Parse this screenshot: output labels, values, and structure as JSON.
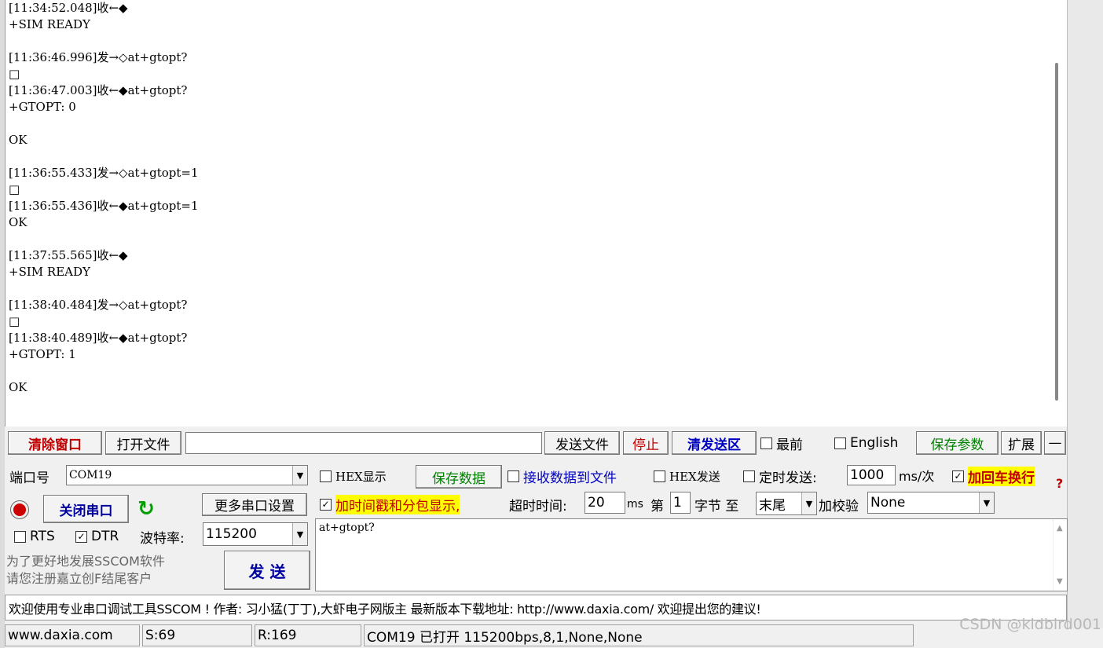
{
  "receive_log": "[11:34:52.048]收←◆\n+SIM READY\n\n[11:36:46.996]发→◇at+gtopt?\n□\n[11:36:47.003]收←◆at+gtopt?\n+GTOPT: 0\n\nOK\n\n[11:36:55.433]发→◇at+gtopt=1\n□\n[11:36:55.436]收←◆at+gtopt=1\nOK\n\n[11:37:55.565]收←◆\n+SIM READY\n\n[11:38:40.484]发→◇at+gtopt?\n□\n[11:38:40.489]收←◆at+gtopt?\n+GTOPT: 1\n\nOK",
  "toolbar": {
    "clear_window": "清除窗口",
    "open_file": "打开文件",
    "file_path": "",
    "send_file": "发送文件",
    "stop": "停止",
    "clear_send": "清发送区",
    "topmost": "最前",
    "english": "English",
    "save_params": "保存参数",
    "expand": "扩展",
    "collapse": "—"
  },
  "port": {
    "port_label": "端口号",
    "port_value": "COM19",
    "close_port": "关闭串口",
    "more_settings": "更多串口设置",
    "rts": "RTS",
    "dtr": "DTR",
    "baud_label": "波特率:",
    "baud_value": "115200"
  },
  "options": {
    "hex_display": "HEX显示",
    "save_data": "保存数据",
    "recv_to_file": "接收数据到文件",
    "hex_send": "HEX发送",
    "timed_send": "定时发送:",
    "interval": "1000",
    "interval_unit": "ms/次",
    "add_crlf": "加回车换行",
    "timestamp": "加时间戳和分包显示,",
    "timeout_label": "超时时间:",
    "timeout_value": "20",
    "timeout_unit": "ms",
    "nth_label": "第",
    "nth_value": "1",
    "byte_to": "字节 至",
    "end_value": "末尾",
    "checksum_label": "加校验",
    "checksum_value": "None",
    "help": "?"
  },
  "send": {
    "text": "at+gtopt?",
    "button": "发  送",
    "promo_line1": "为了更好地发展SSCOM软件",
    "promo_line2": "请您注册嘉立创F结尾客户"
  },
  "banner": "欢迎使用专业串口调试工具SSCOM !  作者: 习小猛(丁丁),大虾电子网版主  最新版本下载地址: http://www.daxia.com/ 欢迎提出您的建议!",
  "status": {
    "site": "www.daxia.com",
    "sent": "S:69",
    "received": "R:169",
    "port_state": "COM19 已打开  115200bps,8,1,None,None"
  },
  "watermark": "CSDN @kidbird001",
  "colors": {
    "record_indicator": "#cc0000",
    "refresh_icon": "#00a000",
    "highlight": "#ffff00"
  }
}
